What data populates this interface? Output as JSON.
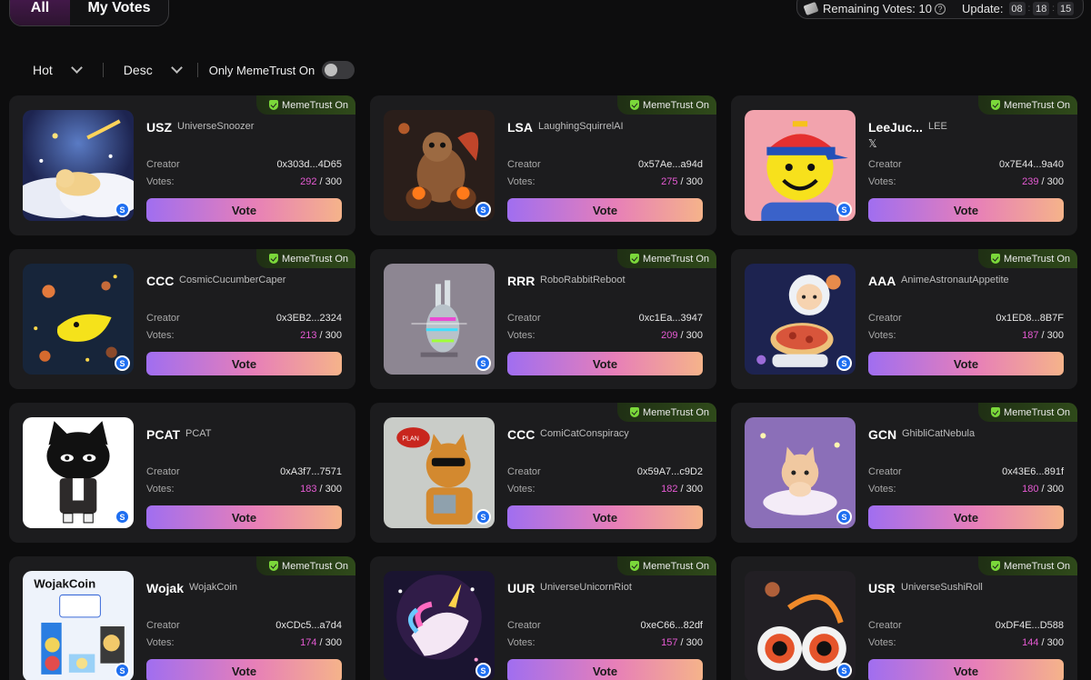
{
  "tabs": {
    "all": "All",
    "my_votes": "My Votes"
  },
  "status": {
    "remaining": "Remaining Votes: 10",
    "help": "?",
    "update_label": "Update:",
    "hh": "08",
    "mm": "18",
    "ss": "15"
  },
  "filters": {
    "sort": "Hot",
    "order": "Desc",
    "toggle_label": "Only MemeTrust On",
    "toggle_on": false
  },
  "labels": {
    "trust": "MemeTrust On",
    "creator": "Creator",
    "votes": "Votes:",
    "vote_button": "Vote",
    "chain_badge": "S",
    "x_icon": "𝕏"
  },
  "colors": {
    "accent_pink": "#e55ad3",
    "trust_green": "#7bd83a",
    "vote_gradient_start": "#a06ef0",
    "vote_gradient_end": "#f5b38a"
  },
  "cards": [
    {
      "ticker": "USZ",
      "name": "UniverseSnoozer",
      "creator": "0x303d...4D65",
      "votes": "292",
      "total": "/ 300",
      "trust": true,
      "art": "snooze"
    },
    {
      "ticker": "LSA",
      "name": "LaughingSquirrelAI",
      "creator": "0x57Ae...a94d",
      "votes": "275",
      "total": "/ 300",
      "trust": true,
      "art": "squirrel"
    },
    {
      "ticker": "LeeJuc...",
      "name": "LEE",
      "creator": "0x7E44...9a40",
      "votes": "239",
      "total": "/ 300",
      "trust": true,
      "art": "lee",
      "x": true
    },
    {
      "ticker": "CCC",
      "name": "CosmicCucumberCaper",
      "creator": "0x3EB2...2324",
      "votes": "213",
      "total": "/ 300",
      "trust": true,
      "art": "cucumber"
    },
    {
      "ticker": "RRR",
      "name": "RoboRabbitReboot",
      "creator": "0xc1Ea...3947",
      "votes": "209",
      "total": "/ 300",
      "trust": true,
      "art": "rabbit"
    },
    {
      "ticker": "AAA",
      "name": "AnimeAstronautAppetite",
      "creator": "0x1ED8...8B7F",
      "votes": "187",
      "total": "/ 300",
      "trust": true,
      "art": "astronaut"
    },
    {
      "ticker": "PCAT",
      "name": "PCAT",
      "creator": "0xA3f7...7571",
      "votes": "183",
      "total": "/ 300",
      "trust": false,
      "art": "pcat"
    },
    {
      "ticker": "CCC",
      "name": "ComiCatConspiracy",
      "creator": "0x59A7...c9D2",
      "votes": "182",
      "total": "/ 300",
      "trust": true,
      "art": "comicat"
    },
    {
      "ticker": "GCN",
      "name": "GhibliCatNebula",
      "creator": "0x43E6...891f",
      "votes": "180",
      "total": "/ 300",
      "trust": true,
      "art": "ghibli"
    },
    {
      "ticker": "Wojak",
      "name": "WojakCoin",
      "creator": "0xCDc5...a7d4",
      "votes": "174",
      "total": "/ 300",
      "trust": true,
      "art": "wojak"
    },
    {
      "ticker": "UUR",
      "name": "UniverseUnicornRiot",
      "creator": "0xeC66...82df",
      "votes": "157",
      "total": "/ 300",
      "trust": true,
      "art": "unicorn"
    },
    {
      "ticker": "USR",
      "name": "UniverseSushiRoll",
      "creator": "0xDF4E...D588",
      "votes": "144",
      "total": "/ 300",
      "trust": true,
      "art": "sushi"
    }
  ]
}
